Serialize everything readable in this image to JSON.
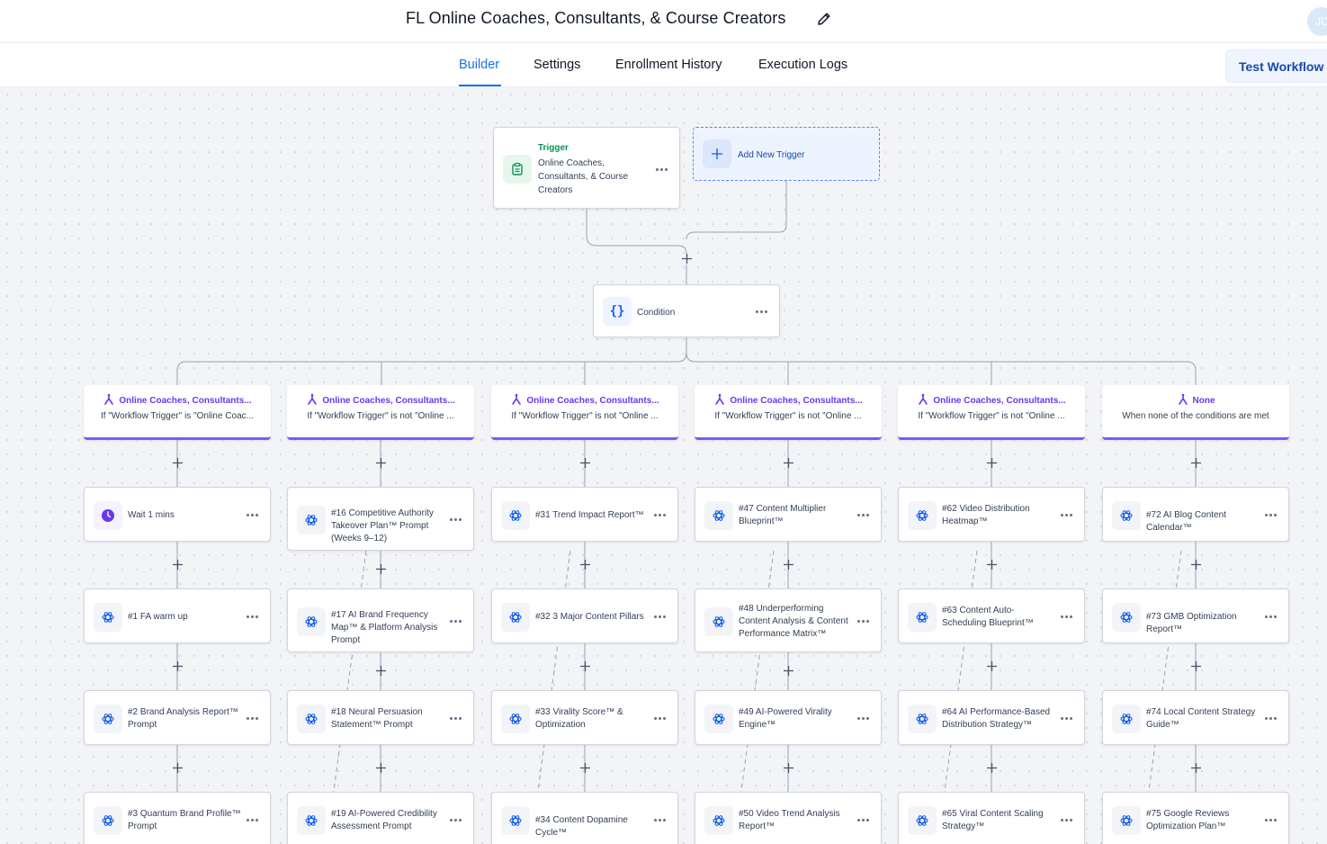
{
  "header": {
    "title": "FL Online Coaches, Consultants, & Course Creators",
    "avatar_initials": "JC",
    "test_button": "Test Workflow"
  },
  "tabs": [
    {
      "label": "Builder",
      "active": true
    },
    {
      "label": "Settings",
      "active": false
    },
    {
      "label": "Enrollment History",
      "active": false
    },
    {
      "label": "Execution Logs",
      "active": false
    }
  ],
  "trigger": {
    "heading": "Trigger",
    "name": "Online Coaches, Consultants, & Course Creators",
    "icon": "clipboard-icon"
  },
  "add_trigger": {
    "label": "Add New Trigger",
    "icon": "plus-icon"
  },
  "condition": {
    "label": "Condition",
    "icon": "braces-icon"
  },
  "branches": [
    {
      "title": "Online Coaches, Consultants...",
      "subtitle": "If \"Workflow Trigger\" is \"Online Coac...",
      "actions": [
        "Wait 1 mins",
        "#1 FA warm up",
        "#2 Brand Analysis Report™ Prompt",
        "#3 Quantum Brand Profile™ Prompt"
      ]
    },
    {
      "title": "Online Coaches, Consultants...",
      "subtitle": "If \"Workflow Trigger\" is not \"Online ...",
      "actions": [
        "#16 Competitive Authority Takeover Plan™ Prompt (Weeks 9–12)",
        "#17 AI Brand Frequency Map™ & Platform Analysis Prompt",
        "#18 Neural Persuasion Statement™ Prompt",
        "#19 AI-Powered Credibility Assessment Prompt"
      ]
    },
    {
      "title": "Online Coaches, Consultants...",
      "subtitle": "If \"Workflow Trigger\" is not \"Online ...",
      "actions": [
        "#31 Trend Impact Report™",
        "#32 3 Major Content Pillars",
        "#33 Virality Score™ & Optimization",
        "#34 Content Dopamine Cycle™"
      ]
    },
    {
      "title": "Online Coaches, Consultants...",
      "subtitle": "If \"Workflow Trigger\" is not \"Online ...",
      "actions": [
        "#47 Content Multiplier Blueprint™",
        "#48 Underperforming Content Analysis & Content Performance Matrix™",
        "#49 AI-Powered Virality Engine™",
        "#50 Video Trend Analysis Report™"
      ]
    },
    {
      "title": "Online Coaches, Consultants...",
      "subtitle": "If \"Workflow Trigger\" is not \"Online ...",
      "actions": [
        "#62 Video Distribution Heatmap™",
        "#63 Content Auto-Scheduling Blueprint™",
        "#64 AI Performance-Based Distribution Strategy™",
        "#65 Viral Content Scaling Strategy™"
      ]
    },
    {
      "title": "None",
      "subtitle": "When none of the conditions are met",
      "actions": [
        "#72 AI Blog Content Calendar™",
        "#73 GMB Optimization Report™",
        "#74 Local Content Strategy Guide™",
        "#75 Google Reviews Optimization Plan™"
      ]
    }
  ],
  "colors": {
    "accent": "#1570ef",
    "branch": "#7a5af8",
    "trigger": "#079455",
    "wait": "#6938ef",
    "openai": "#155eef"
  }
}
